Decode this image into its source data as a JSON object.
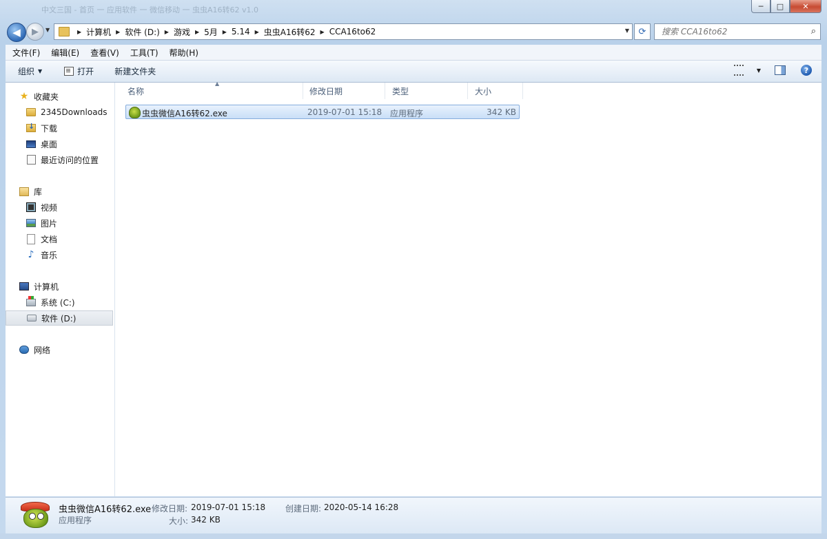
{
  "window": {
    "title_blur": "中文三国 - 首页 一 应用软件 一 微信移动 一 虫虫A16转62 v1.0",
    "controls": {
      "minimize": "─",
      "maximize": "□",
      "close": "✕"
    }
  },
  "nav": {
    "back": "◀",
    "forward": "▶"
  },
  "address": {
    "crumbs": [
      "计算机",
      "软件 (D:)",
      "游戏",
      "5月",
      "5.14",
      "虫虫A16转62",
      "CCA16to62"
    ]
  },
  "search": {
    "placeholder": "搜索 CCA16to62"
  },
  "menu": [
    "文件(F)",
    "编辑(E)",
    "查看(V)",
    "工具(T)",
    "帮助(H)"
  ],
  "toolbar": {
    "organize": "组织",
    "open": "打开",
    "new_folder": "新建文件夹",
    "help": "?"
  },
  "sidebar": {
    "favorites": {
      "label": "收藏夹",
      "items": [
        "2345Downloads",
        "下载",
        "桌面",
        "最近访问的位置"
      ]
    },
    "libraries": {
      "label": "库",
      "items": [
        "视频",
        "图片",
        "文档",
        "音乐"
      ]
    },
    "computer": {
      "label": "计算机",
      "items": [
        "系统 (C:)",
        "软件 (D:)"
      ],
      "selected": "软件 (D:)"
    },
    "network": {
      "label": "网络"
    }
  },
  "columns": {
    "name": "名称",
    "modified": "修改日期",
    "type": "类型",
    "size": "大小"
  },
  "files": [
    {
      "name": "虫虫微信A16转62.exe",
      "modified": "2019-07-01 15:18",
      "type": "应用程序",
      "size": "342 KB"
    }
  ],
  "details": {
    "filename": "虫虫微信A16转62.exe",
    "filetype": "应用程序",
    "modified_label": "修改日期:",
    "modified": "2019-07-01 15:18",
    "created_label": "创建日期:",
    "created": "2020-05-14 16:28",
    "size_label": "大小:",
    "size": "342 KB"
  }
}
